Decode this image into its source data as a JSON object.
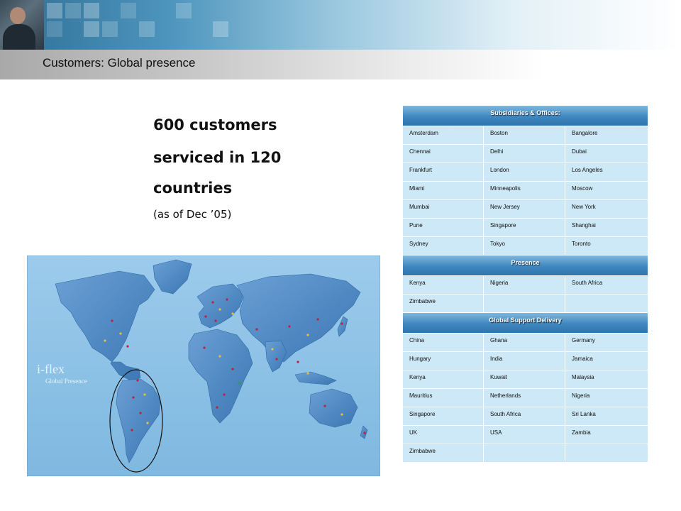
{
  "header": {
    "title": "Customers: Global presence"
  },
  "headline": {
    "line1": "600 customers",
    "line2": "serviced in 120",
    "line3": "countries",
    "note": "(as of Dec ’05)"
  },
  "map": {
    "brand": "i-flex",
    "caption": "Global Presence",
    "ocean_color": "#8ec3e6",
    "land_color": "#4a86c2"
  },
  "sections": [
    {
      "title": "Subsidiaries & Offices:",
      "rows": [
        [
          "Amsterdam",
          "Boston",
          "Bangalore"
        ],
        [
          "Chennai",
          "Delhi",
          "Dubai"
        ],
        [
          "Frankfurt",
          "London",
          "Los Angeles"
        ],
        [
          "Miami",
          "Minneapolis",
          "Moscow"
        ],
        [
          "Mumbai",
          "New Jersey",
          "New York"
        ],
        [
          "Pune",
          "Singapore",
          "Shanghai"
        ],
        [
          "Sydney",
          "Tokyo",
          "Toronto"
        ]
      ]
    },
    {
      "title": "Presence",
      "rows": [
        [
          "Kenya",
          "Nigeria",
          "South Africa"
        ],
        [
          "Zimbabwe",
          "",
          ""
        ]
      ]
    },
    {
      "title": "Global Support Delivery",
      "rows": [
        [
          "China",
          "Ghana",
          "Germany"
        ],
        [
          "Hungary",
          "India",
          "Jamaica"
        ],
        [
          "Kenya",
          "Kuwait",
          "Malaysia"
        ],
        [
          "Mauritius",
          "Netherlands",
          "Nigeria"
        ],
        [
          "Singapore",
          "South Africa",
          "Sri Lanka"
        ],
        [
          "UK",
          "USA",
          "Zambia"
        ],
        [
          "Zimbabwe",
          "",
          ""
        ]
      ]
    }
  ]
}
